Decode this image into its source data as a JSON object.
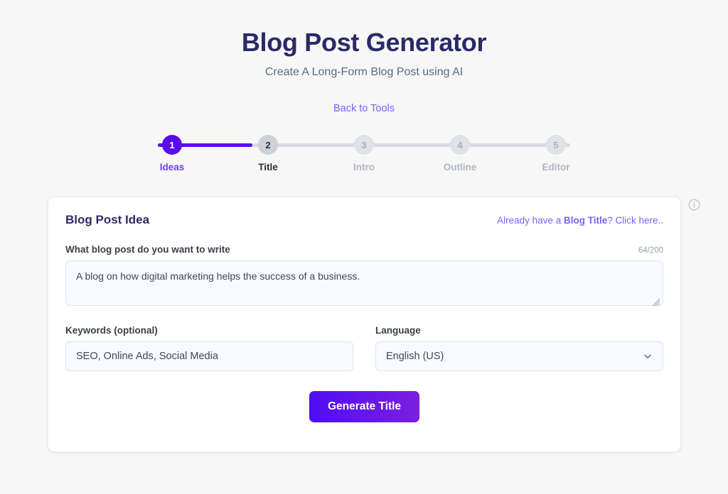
{
  "header": {
    "title": "Blog Post Generator",
    "subtitle": "Create A Long-Form Blog Post using AI",
    "back_link": "Back to Tools"
  },
  "stepper": {
    "active_step": 1,
    "steps": [
      {
        "number": "1",
        "label": "Ideas",
        "state": "active"
      },
      {
        "number": "2",
        "label": "Title",
        "state": "next"
      },
      {
        "number": "3",
        "label": "Intro",
        "state": "todo"
      },
      {
        "number": "4",
        "label": "Outline",
        "state": "todo"
      },
      {
        "number": "5",
        "label": "Editor",
        "state": "todo"
      }
    ]
  },
  "card": {
    "title": "Blog Post Idea",
    "head_link": {
      "prefix": "Already have a ",
      "strong": "Blog Title",
      "suffix": "? Click here.."
    },
    "prompt": {
      "label": "What blog post do you want to write",
      "counter": "64/200",
      "value": "A blog on how digital marketing helps the success of a business.",
      "placeholder": "What blog post do you want to write"
    },
    "keywords": {
      "label": "Keywords (optional)",
      "value": "SEO, Online Ads, Social Media",
      "placeholder": "Keywords (optional)"
    },
    "language": {
      "label": "Language",
      "value": "English (US)"
    },
    "submit_label": "Generate Title"
  },
  "icons": {
    "info": "info-icon",
    "chevron": "chevron-down-icon",
    "resize": "resize-grip-icon"
  },
  "colors": {
    "accent": "#5b0ceb",
    "link": "#7b61f8",
    "title": "#2a2a66",
    "page_bg": "#f7f7f8",
    "field_bg": "#f8faff"
  }
}
